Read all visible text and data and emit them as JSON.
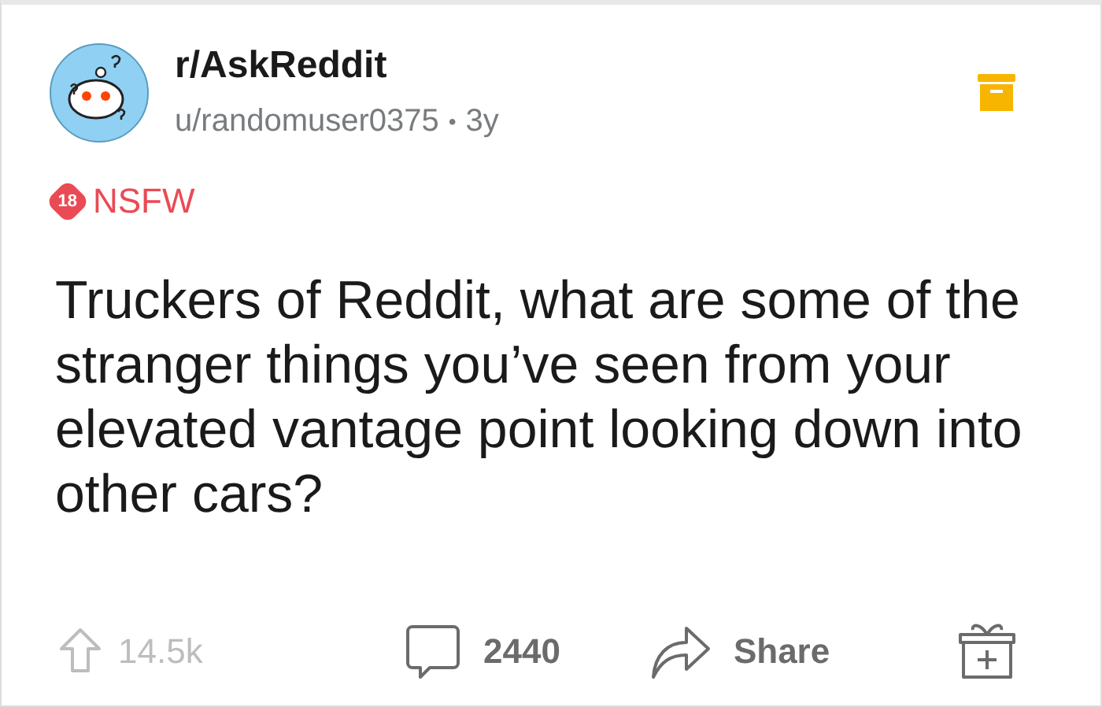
{
  "post": {
    "subreddit": "r/AskReddit",
    "author": "u/randomuser0375",
    "separator": "•",
    "age": "3y",
    "nsfw_badge": "18",
    "nsfw_label": "NSFW",
    "title": "Truckers of Reddit, what are some of the stranger things you’ve seen from your elevated vantage point looking down into other cars?"
  },
  "actions": {
    "votes": "14.5k",
    "comments": "2440",
    "share": "Share"
  }
}
